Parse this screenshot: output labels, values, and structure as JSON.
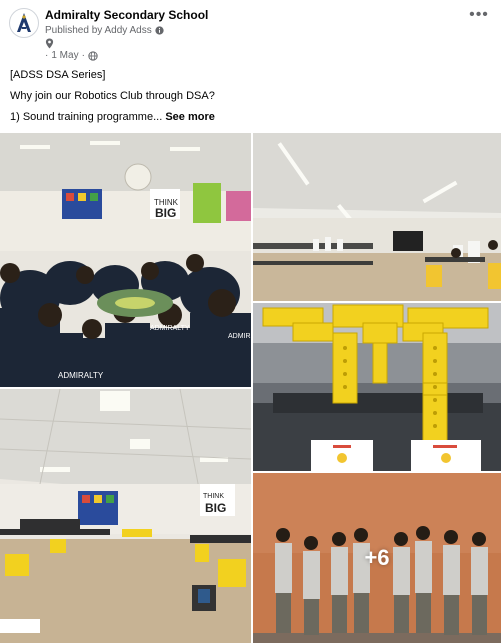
{
  "header": {
    "page_name": "Admiralty Secondary School",
    "published_by": "Published by Addy Adss",
    "date": "1 May",
    "more_icon": "three-dots-icon"
  },
  "post": {
    "line1": "[ADSS DSA Series]",
    "line2": "Why join our Robotics Club through DSA?",
    "line3": "1) Sound training programme...",
    "see_more": "See more"
  },
  "photos": {
    "count": 5,
    "more_count": "+6"
  }
}
